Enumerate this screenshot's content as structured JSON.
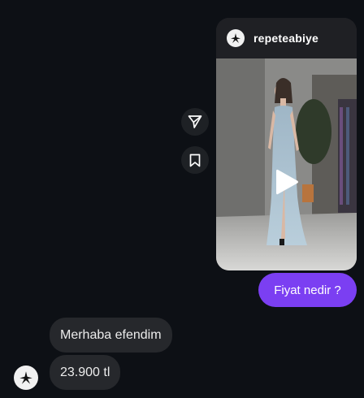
{
  "shared_reel": {
    "username": "repeteabiye",
    "avatar_icon": "brand-logo-icon",
    "media_icon": "play-icon",
    "type_icon": "reels-icon"
  },
  "actions": {
    "share_icon": "send-icon",
    "save_icon": "bookmark-icon"
  },
  "messages": {
    "sent": [
      "Fiyat nedir ?"
    ],
    "received": [
      "Merhaba efendim",
      "23.900 tl"
    ]
  },
  "colors": {
    "background": "#0d1015",
    "sent_bubble": "#7b3ff2",
    "received_bubble": "#26282c"
  }
}
